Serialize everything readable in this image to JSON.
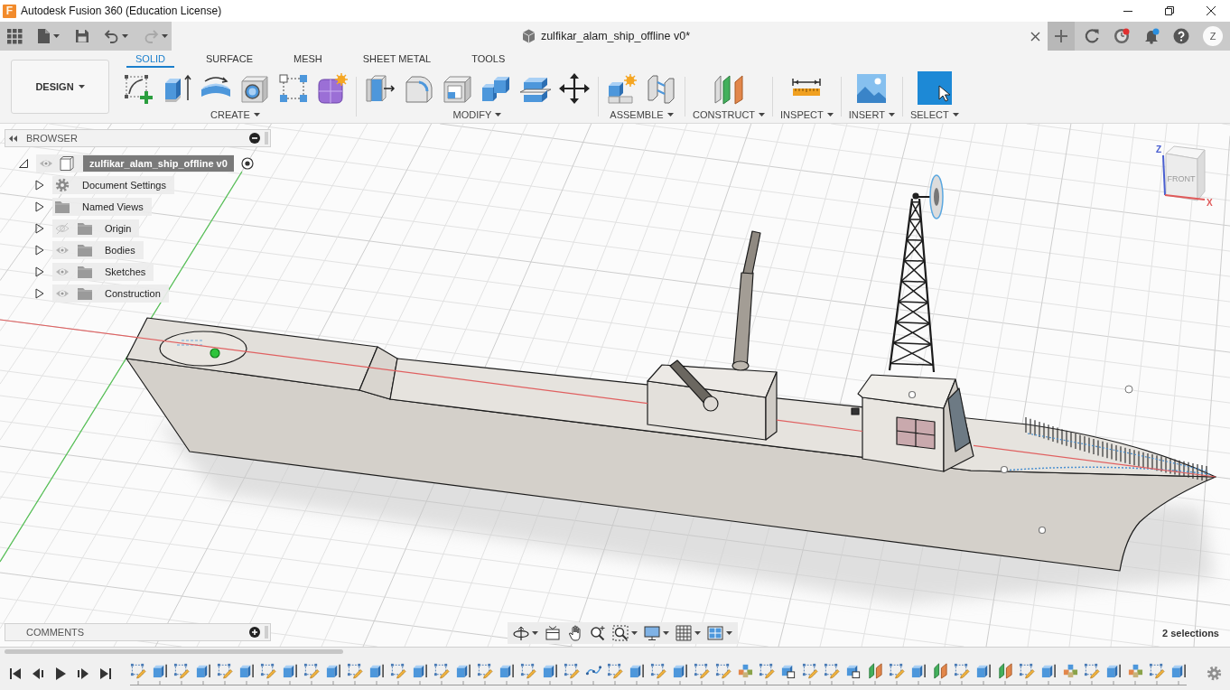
{
  "window": {
    "logo": "F",
    "title": "Autodesk Fusion 360 (Education License)"
  },
  "quick_access": {
    "undo": {
      "disabled": false
    },
    "redo": {
      "disabled": true
    }
  },
  "document_tab": {
    "title": "zulfikar_alam_ship_offline v0*"
  },
  "header": {
    "job_status": {
      "alert": true
    },
    "notifications": {
      "unread": true
    },
    "user_initial": "Z"
  },
  "ribbon": {
    "workspace": "DESIGN",
    "tabs": [
      {
        "label": "SOLID",
        "selected": true
      },
      {
        "label": "SURFACE",
        "selected": false
      },
      {
        "label": "MESH",
        "selected": false
      },
      {
        "label": "SHEET METAL",
        "selected": false
      },
      {
        "label": "TOOLS",
        "selected": false
      }
    ],
    "groups": [
      {
        "label": "CREATE"
      },
      {
        "label": "MODIFY"
      },
      {
        "label": "ASSEMBLE"
      },
      {
        "label": "CONSTRUCT"
      },
      {
        "label": "INSPECT"
      },
      {
        "label": "INSERT"
      },
      {
        "label": "SELECT"
      }
    ]
  },
  "browser": {
    "title": "BROWSER",
    "root": {
      "label": "zulfikar_alam_ship_offline v0",
      "kind": "component",
      "expanded": true,
      "visible": true,
      "active": true,
      "children": [
        {
          "label": "Document Settings",
          "kind": "settings",
          "expanded": false
        },
        {
          "label": "Named Views",
          "kind": "folder",
          "expanded": false
        },
        {
          "label": "Origin",
          "kind": "folder",
          "expanded": false,
          "visible": false
        },
        {
          "label": "Bodies",
          "kind": "folder",
          "expanded": false,
          "visible": true
        },
        {
          "label": "Sketches",
          "kind": "folder",
          "expanded": false,
          "visible": true
        },
        {
          "label": "Construction",
          "kind": "folder",
          "expanded": false,
          "visible": true
        }
      ]
    }
  },
  "viewcube": {
    "face": "FRONT",
    "z_axis": "Z",
    "x_axis": "X"
  },
  "comments": {
    "title": "COMMENTS"
  },
  "status": {
    "selection": "2 selections"
  },
  "timeline": {
    "items": [
      {
        "kind": "sketch"
      },
      {
        "kind": "extrude"
      },
      {
        "kind": "sketch"
      },
      {
        "kind": "extrude"
      },
      {
        "kind": "sketch"
      },
      {
        "kind": "extrude"
      },
      {
        "kind": "sketch"
      },
      {
        "kind": "extrude"
      },
      {
        "kind": "sketch"
      },
      {
        "kind": "extrude"
      },
      {
        "kind": "sketch"
      },
      {
        "kind": "extrude"
      },
      {
        "kind": "sketch"
      },
      {
        "kind": "extrude"
      },
      {
        "kind": "sketch"
      },
      {
        "kind": "extrude"
      },
      {
        "kind": "sketch"
      },
      {
        "kind": "extrude"
      },
      {
        "kind": "sketch"
      },
      {
        "kind": "extrude"
      },
      {
        "kind": "sketch"
      },
      {
        "kind": "spline"
      },
      {
        "kind": "sketch"
      },
      {
        "kind": "extrude"
      },
      {
        "kind": "sketch"
      },
      {
        "kind": "extrude"
      },
      {
        "kind": "sketch"
      },
      {
        "kind": "sketch"
      },
      {
        "kind": "pattern"
      },
      {
        "kind": "sketch"
      },
      {
        "kind": "combine"
      },
      {
        "kind": "sketch"
      },
      {
        "kind": "sketch"
      },
      {
        "kind": "combine"
      },
      {
        "kind": "plane"
      },
      {
        "kind": "sketch"
      },
      {
        "kind": "extrude"
      },
      {
        "kind": "plane"
      },
      {
        "kind": "sketch"
      },
      {
        "kind": "extrude"
      },
      {
        "kind": "plane"
      },
      {
        "kind": "sketch"
      },
      {
        "kind": "extrude"
      },
      {
        "kind": "pattern"
      },
      {
        "kind": "sketch"
      },
      {
        "kind": "extrude"
      },
      {
        "kind": "pattern"
      },
      {
        "kind": "sketch"
      },
      {
        "kind": "extrude"
      }
    ]
  }
}
